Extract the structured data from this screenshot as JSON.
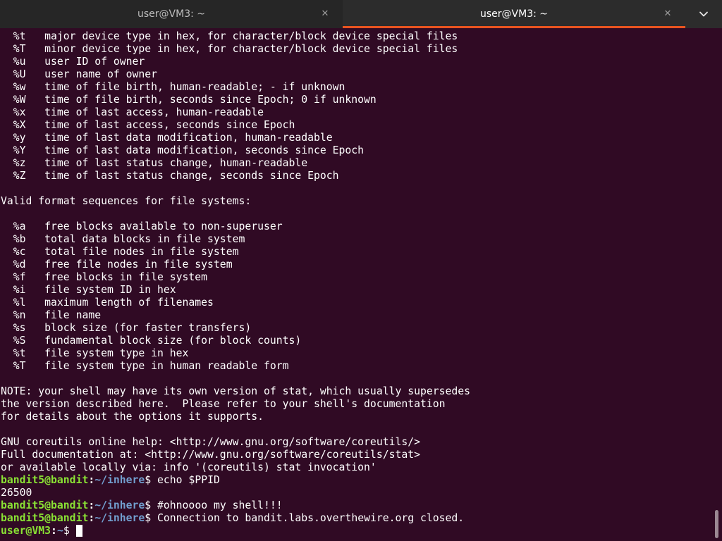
{
  "tabs": [
    {
      "title": "user@VM3: ~",
      "close_icon": "✕"
    },
    {
      "title": "user@VM3: ~",
      "close_icon": "✕"
    }
  ],
  "menu_icon": "chevron-down-icon",
  "colors": {
    "background": "#300a24",
    "prompt_user": "#8ae234",
    "prompt_path": "#729fcf",
    "active_tab_accent": "#e95420"
  },
  "terminal": {
    "lines": [
      "  %t   major device type in hex, for character/block device special files",
      "  %T   minor device type in hex, for character/block device special files",
      "  %u   user ID of owner",
      "  %U   user name of owner",
      "  %w   time of file birth, human-readable; - if unknown",
      "  %W   time of file birth, seconds since Epoch; 0 if unknown",
      "  %x   time of last access, human-readable",
      "  %X   time of last access, seconds since Epoch",
      "  %y   time of last data modification, human-readable",
      "  %Y   time of last data modification, seconds since Epoch",
      "  %z   time of last status change, human-readable",
      "  %Z   time of last status change, seconds since Epoch",
      "",
      "Valid format sequences for file systems:",
      "",
      "  %a   free blocks available to non-superuser",
      "  %b   total data blocks in file system",
      "  %c   total file nodes in file system",
      "  %d   free file nodes in file system",
      "  %f   free blocks in file system",
      "  %i   file system ID in hex",
      "  %l   maximum length of filenames",
      "  %n   file name",
      "  %s   block size (for faster transfers)",
      "  %S   fundamental block size (for block counts)",
      "  %t   file system type in hex",
      "  %T   file system type in human readable form",
      "",
      "NOTE: your shell may have its own version of stat, which usually supersedes",
      "the version described here.  Please refer to your shell's documentation",
      "for details about the options it supports.",
      "",
      "GNU coreutils online help: <http://www.gnu.org/software/coreutils/>",
      "Full documentation at: <http://www.gnu.org/software/coreutils/stat>",
      "or available locally via: info '(coreutils) stat invocation'"
    ],
    "session": [
      {
        "type": "prompt",
        "user": "bandit5@bandit",
        "sep": ":",
        "path": "~/inhere",
        "dollar": "$ ",
        "command": "echo $PPID"
      },
      {
        "type": "output",
        "text": "26500"
      },
      {
        "type": "prompt",
        "user": "bandit5@bandit",
        "sep": ":",
        "path": "~/inhere",
        "dollar": "$ ",
        "command": "#ohnoooo my shell!!!"
      },
      {
        "type": "prompt",
        "user": "bandit5@bandit",
        "sep": ":",
        "path": "~/inhere",
        "dollar": "$ ",
        "command": "Connection to bandit.labs.overthewire.org closed."
      },
      {
        "type": "prompt",
        "user": "user@VM3",
        "sep": ":",
        "path": "~",
        "dollar": "$ ",
        "command": "",
        "cursor": true
      }
    ]
  }
}
